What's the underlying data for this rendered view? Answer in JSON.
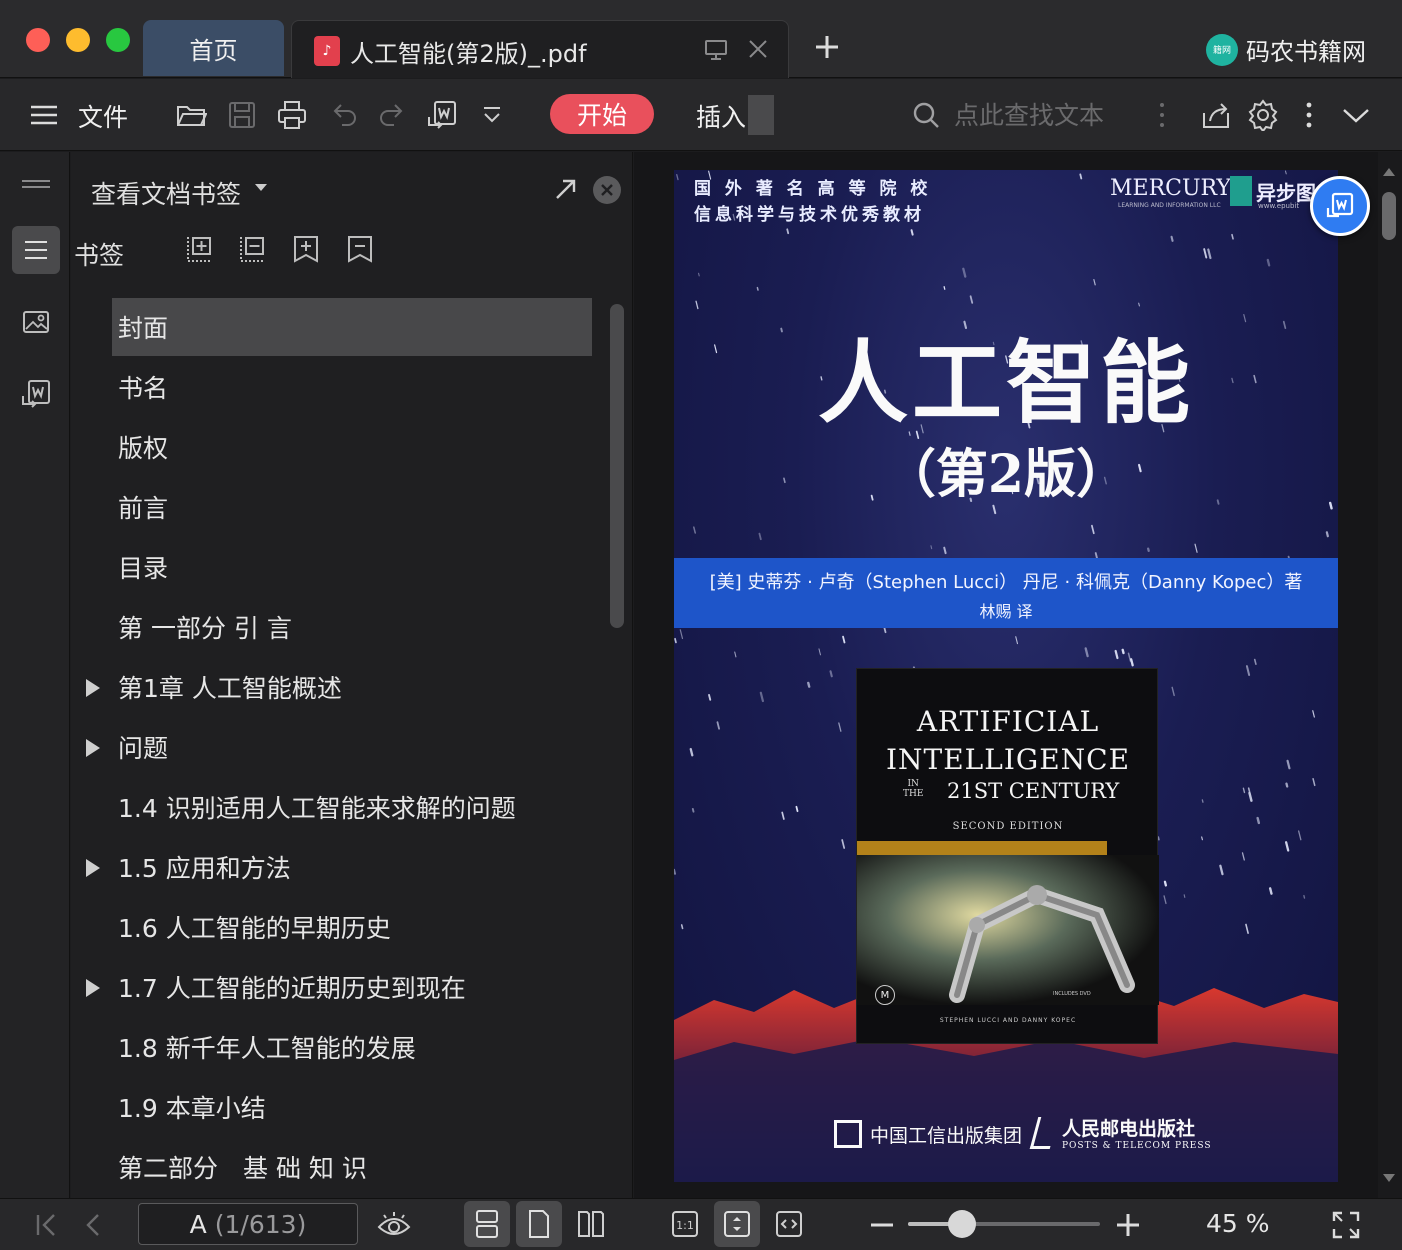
{
  "window": {
    "tabs": [
      {
        "label": "首页"
      },
      {
        "label": "人工智能(第2版)_.pdf"
      }
    ],
    "brand": {
      "name": "码农书籍网",
      "logo_text": "籍网",
      "logo_color": "#1fb3a0"
    }
  },
  "toolbar": {
    "menu_label": "文件",
    "start_label": "开始",
    "insert_label": "插入",
    "search_placeholder": "点此查找文本",
    "accent_color": "#e9505c"
  },
  "sidebar": {
    "title": "查看文档书签",
    "section_label": "书签",
    "items": [
      {
        "label": "封面",
        "expandable": false,
        "selected": true
      },
      {
        "label": "书名",
        "expandable": false
      },
      {
        "label": "版权",
        "expandable": false
      },
      {
        "label": "前言",
        "expandable": false
      },
      {
        "label": "目录",
        "expandable": false
      },
      {
        "label": "第 一部分 引 言",
        "expandable": false
      },
      {
        "label": "第1章 人工智能概述",
        "expandable": true
      },
      {
        "label": "问题",
        "expandable": true
      },
      {
        "label": "1.4 识别适用人工智能来求解的问题",
        "expandable": false
      },
      {
        "label": "1.5 应用和方法",
        "expandable": true
      },
      {
        "label": "1.6 人工智能的早期历史",
        "expandable": false
      },
      {
        "label": "1.7 人工智能的近期历史到现在",
        "expandable": true
      },
      {
        "label": "1.8 新千年人工智能的发展",
        "expandable": false
      },
      {
        "label": "1.9 本章小结",
        "expandable": false
      },
      {
        "label": "第二部分　基 础 知 识",
        "expandable": false
      }
    ]
  },
  "cover": {
    "series": "国 外 著 名 高 等 院 校\n信息科学与技术优秀教材",
    "mercury": "MERCURY",
    "mercury_sub": "LEARNING AND INFORMATION LLC",
    "epubit": "异步图",
    "epubit_url": "www.epubit",
    "title": "人工智能",
    "edition": "（第2版）",
    "authors": "[美] 史蒂芬 · 卢奇（Stephen Lucci）  丹尼 · 科佩克（Danny Kopec）著",
    "translator": "林赐 译",
    "inner_book": {
      "title_line1": "ARTIFICIAL",
      "title_line2": "INTELLIGENCE",
      "in_the": "IN\nTHE",
      "century": "21ST CENTURY",
      "edition": "SECOND EDITION",
      "dvd": "INCLUDES DVD",
      "authors": "STEPHEN LUCCI AND DANNY KOPEC",
      "logo": "M"
    },
    "publisher1": "中国工信出版集团",
    "publisher2": "人民邮电出版社",
    "publisher2_en": "POSTS & TELECOM PRESS",
    "band_color": "#1e55c9"
  },
  "statusbar": {
    "page_letter": "A",
    "page_indicator": "(1/613)",
    "zoom_label": "45 %",
    "zoom_fraction": 0.28
  }
}
